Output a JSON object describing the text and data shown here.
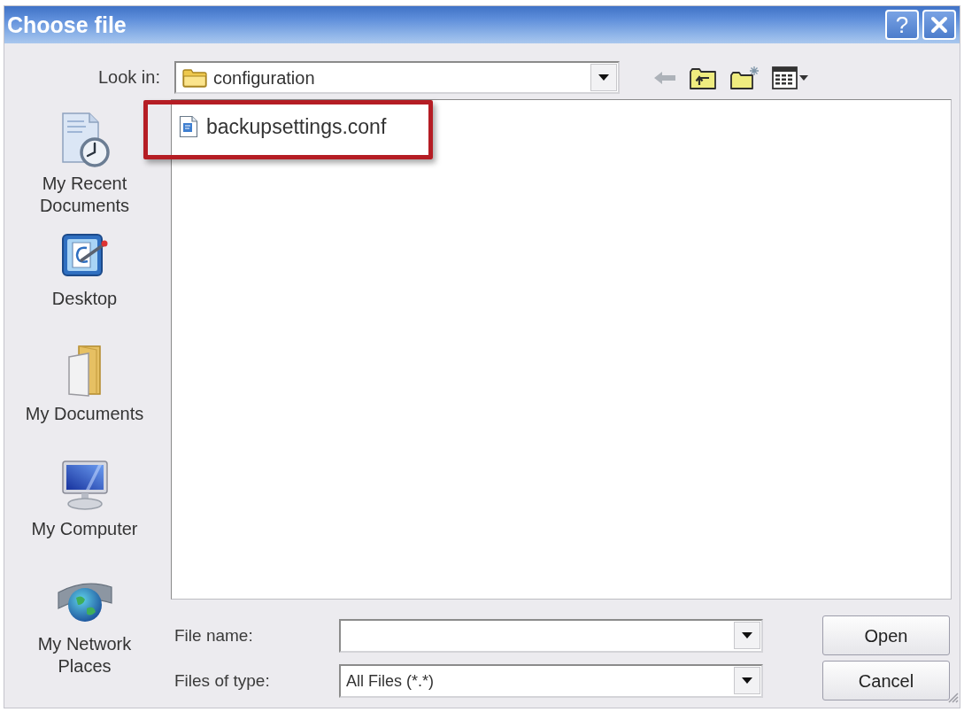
{
  "window": {
    "title": "Choose file",
    "help_label": "?"
  },
  "look_in": {
    "label": "Look in:",
    "value": "configuration"
  },
  "toolbar": [
    {
      "kind": "back",
      "disabled": true
    },
    {
      "kind": "up",
      "disabled": false
    },
    {
      "kind": "new_folder",
      "disabled": false
    },
    {
      "kind": "views",
      "disabled": false
    }
  ],
  "places": [
    {
      "kind": "recent",
      "label": "My Recent Documents"
    },
    {
      "kind": "desktop",
      "label": "Desktop"
    },
    {
      "kind": "documents",
      "label": "My Documents"
    },
    {
      "kind": "computer",
      "label": "My Computer"
    },
    {
      "kind": "network",
      "label": "My Network Places"
    }
  ],
  "files": [
    {
      "name": "backupsettings.conf",
      "highlighted": true
    }
  ],
  "file_name": {
    "label": "File name:"
  },
  "file_type": {
    "label": "Files of type:",
    "value": "All Files (*.*)"
  },
  "buttons": [
    {
      "label": "Open"
    },
    {
      "label": "Cancel"
    }
  ]
}
